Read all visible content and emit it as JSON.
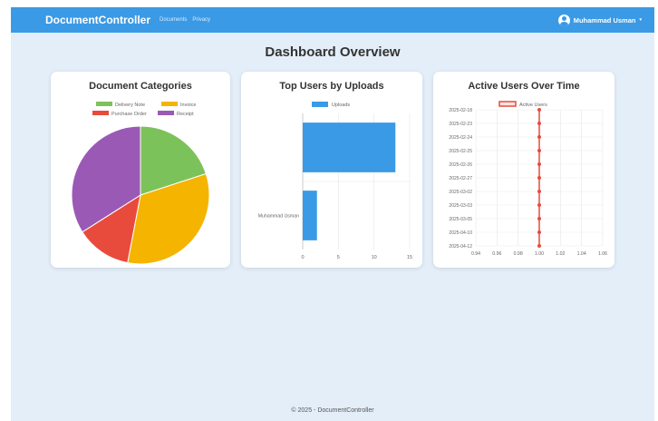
{
  "navbar": {
    "brand": "DocumentController",
    "links": [
      "Documents",
      "Privacy"
    ],
    "user_name": "Muhammad Usman",
    "caret": "▾"
  },
  "page_title": "Dashboard Overview",
  "footer": "© 2025 - DocumentController",
  "cards": {
    "categories": {
      "title": "Document Categories"
    },
    "uploads": {
      "title": "Top Users by Uploads"
    },
    "active": {
      "title": "Active Users Over Time"
    }
  },
  "chart_data": [
    {
      "type": "pie",
      "title": "Document Categories",
      "legend_position": "top",
      "categories": [
        "Delivery Note",
        "Invoice",
        "Purchase Order",
        "Receipt"
      ],
      "values": [
        20,
        33,
        13,
        34
      ],
      "colors": [
        "#7cc25a",
        "#f4b400",
        "#e84b3c",
        "#9b59b6"
      ]
    },
    {
      "type": "bar",
      "orientation": "horizontal",
      "title": "Top Users by Uploads",
      "legend_position": "top",
      "categories": [
        "",
        "Muhammad Usman"
      ],
      "series": [
        {
          "name": "Uploads",
          "values": [
            13,
            2
          ],
          "color": "#3a9ae6"
        }
      ],
      "xlim": [
        0,
        15
      ],
      "xticks": [
        0,
        5,
        10,
        15
      ]
    },
    {
      "type": "line",
      "title": "Active Users Over Time",
      "legend_position": "top",
      "y_categories": [
        "2025-02-18",
        "2025-02-23",
        "2025-02-24",
        "2025-02-25",
        "2025-02-26",
        "2025-02-27",
        "2025-03-02",
        "2025-03-03",
        "2025-03-05",
        "2025-04-10",
        "2025-04-12"
      ],
      "series": [
        {
          "name": "Active Users",
          "values": [
            1,
            1,
            1,
            1,
            1,
            1,
            1,
            1,
            1,
            1,
            1
          ],
          "color": "#e74c3c"
        }
      ],
      "xlim": [
        0.94,
        1.06
      ],
      "xticks": [
        "0.94",
        "0.96",
        "0.98",
        "1.00",
        "1.02",
        "1.04",
        "1.06"
      ]
    }
  ]
}
